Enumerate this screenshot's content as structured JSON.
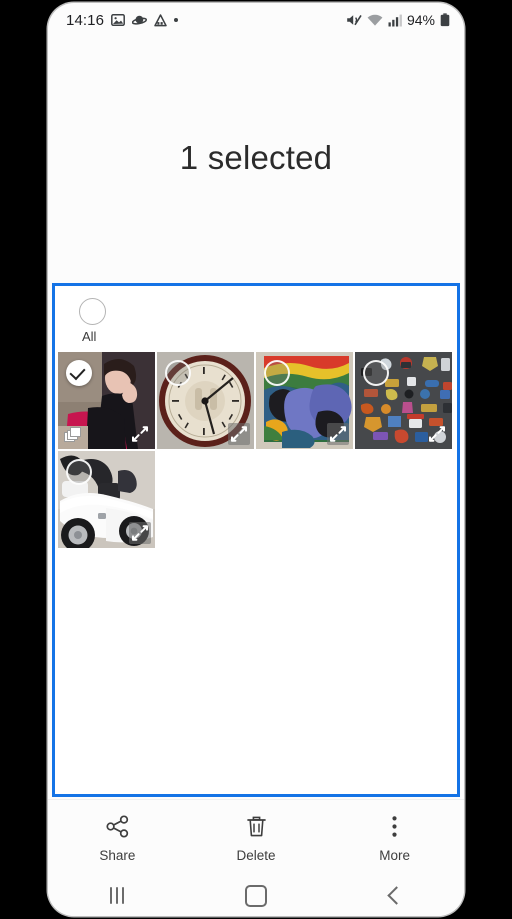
{
  "statusbar": {
    "time": "14:16",
    "battery": "94%",
    "left_icons": [
      "image-icon",
      "saturn-icon",
      "android-auto-icon",
      "dot-icon"
    ],
    "right_icons": [
      "mute-icon",
      "wifi-icon",
      "signal-icon",
      "battery-icon"
    ]
  },
  "header": {
    "title": "1 selected"
  },
  "selection": {
    "all_label": "All",
    "all_checked": false,
    "highlight_color": "#1473e6"
  },
  "grid": {
    "items": [
      {
        "name": "portrait-woman-leather-jacket",
        "selected": true,
        "burst": true,
        "expandable": true,
        "expand_plate": false
      },
      {
        "name": "antique-roman-numeral-clock",
        "selected": false,
        "burst": false,
        "expandable": true,
        "expand_plate": true
      },
      {
        "name": "blue-horses-painting",
        "selected": false,
        "burst": false,
        "expandable": true,
        "expand_plate": true
      },
      {
        "name": "pin-badge-collection-board",
        "selected": false,
        "burst": false,
        "expandable": true,
        "expand_plate": false
      },
      {
        "name": "white-toy-ride-on-car",
        "selected": false,
        "burst": false,
        "expandable": true,
        "expand_plate": true
      }
    ]
  },
  "actionbar": {
    "actions": [
      {
        "label": "Share",
        "icon": "share-icon"
      },
      {
        "label": "Delete",
        "icon": "trash-icon"
      },
      {
        "label": "More",
        "icon": "overflow-menu-icon"
      }
    ]
  },
  "navbar": {
    "recents_label": "Recents",
    "home_label": "Home",
    "back_label": "Back"
  }
}
